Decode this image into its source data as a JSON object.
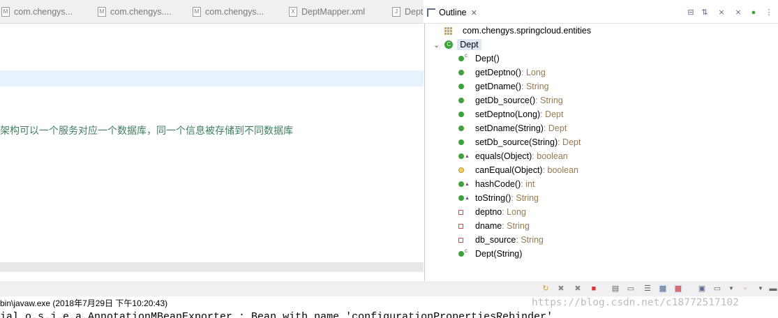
{
  "editor": {
    "tabs": [
      {
        "label": "com.chengys...",
        "icon": "java-file-icon"
      },
      {
        "label": "com.chengys....",
        "icon": "java-file-icon"
      },
      {
        "label": "com.chengys...",
        "icon": "java-file-icon"
      },
      {
        "label": "DeptMapper.xml",
        "icon": "xml-file-icon"
      },
      {
        "label": "Dept",
        "icon": "java-file-icon"
      }
    ],
    "comment_line": "架构可以一个服务对应一个数据库，同一个信息被存储到不同数据库"
  },
  "outline": {
    "title": "Outline",
    "package": "com.chengys.springcloud.entities",
    "class_name": "Dept",
    "members": [
      {
        "name": "Dept()",
        "type": "",
        "kind": "constructor"
      },
      {
        "name": "getDeptno()",
        "type": " : Long",
        "kind": "method"
      },
      {
        "name": "getDname()",
        "type": " : String",
        "kind": "method"
      },
      {
        "name": "getDb_source()",
        "type": " : String",
        "kind": "method"
      },
      {
        "name": "setDeptno(Long)",
        "type": " : Dept",
        "kind": "method"
      },
      {
        "name": "setDname(String)",
        "type": " : Dept",
        "kind": "method"
      },
      {
        "name": "setDb_source(String)",
        "type": " : Dept",
        "kind": "method"
      },
      {
        "name": "equals(Object)",
        "type": " : boolean",
        "kind": "override"
      },
      {
        "name": "canEqual(Object)",
        "type": " : boolean",
        "kind": "protected"
      },
      {
        "name": "hashCode()",
        "type": " : int",
        "kind": "override"
      },
      {
        "name": "toString()",
        "type": " : String",
        "kind": "override"
      },
      {
        "name": "deptno",
        "type": " : Long",
        "kind": "field"
      },
      {
        "name": "dname",
        "type": " : String",
        "kind": "field"
      },
      {
        "name": "db_source",
        "type": " : String",
        "kind": "field"
      },
      {
        "name": "Dept(String)",
        "type": "",
        "kind": "constructor"
      }
    ]
  },
  "console": {
    "launch_title": "bin\\javaw.exe (2018年7月29日 下午10:20:43)",
    "output_line": "ial o.s.j.e.a.AnnotationMBeanExporter        : Bean with name 'configurationPropertiesRebinder'",
    "watermark": "https://blog.csdn.net/c18772517102"
  },
  "colors": {
    "comment_green": "#3f7f5f",
    "return_type": "#957b4f",
    "method_public": "#3ca33c",
    "field_private": "#d54848",
    "selection": "#dde9f7",
    "current_line": "#e8f2fe"
  }
}
